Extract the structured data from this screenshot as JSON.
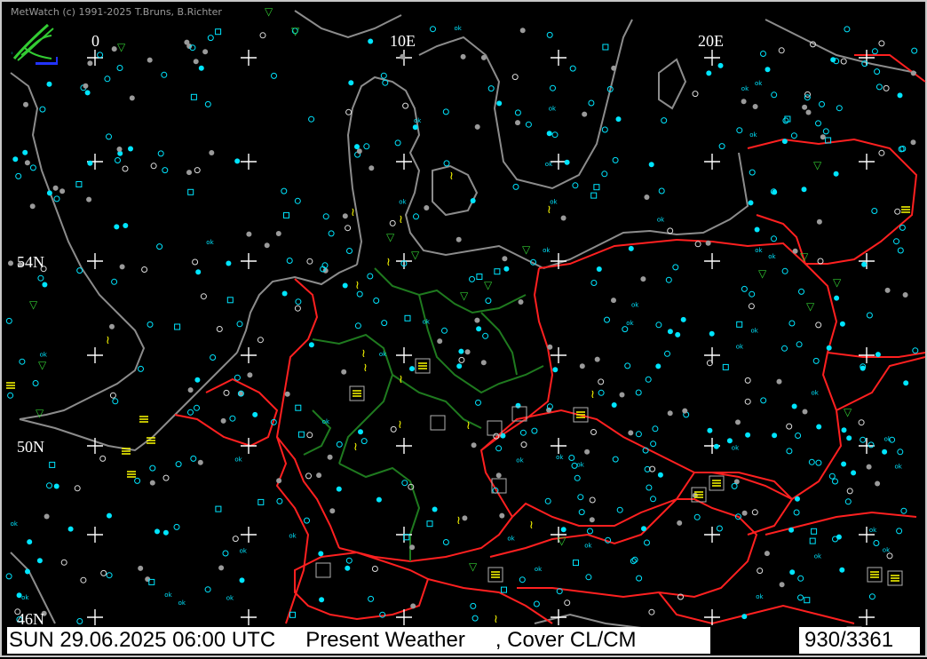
{
  "app": {
    "copyright": "MetWatch  (c) 1991-2025 T.Bruns, B.Richter",
    "logo_icon": "metwatch-logo-icon"
  },
  "map": {
    "longitude_labels": [
      "0",
      "10E",
      "20E"
    ],
    "latitude_labels": [
      "54N",
      "50N",
      "46N"
    ],
    "colors": {
      "background": "#000000",
      "coastline": "#8c8c8c",
      "country_border": "#ff2020",
      "region_border": "#1f7a1f",
      "station_cyan": "#00e5ff",
      "station_gray": "#9a9a9a",
      "symbol_yellow": "#ffff00",
      "symbol_green": "#33cc33"
    },
    "ok_label": "ok"
  },
  "status": {
    "datetime": "SUN 29.06.2025 06:00 UTC",
    "product": "Present Weather",
    "layer": ", Cover CL/CM",
    "count": "930/3361"
  }
}
